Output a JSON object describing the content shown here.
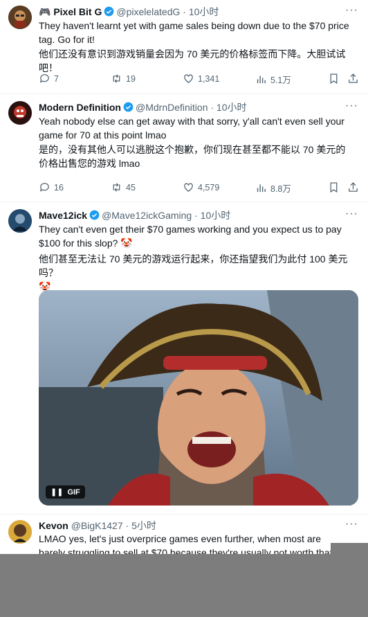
{
  "colors": {
    "verified": "#1d9bf0",
    "text": "#0f1419",
    "muted": "#536471",
    "overlay": "#7d7d7d"
  },
  "tweets": [
    {
      "name_prefix_icon": "gamepad-icon",
      "name": "Pixel Bit G",
      "handle": "@pixelelatedG",
      "time": "· 10小时",
      "text_en": "They haven't learnt yet with game sales being down due to the $70 price tag.  Go for it!",
      "text_zh": "他们还没有意识到游戏销量会因为 70 美元的价格标签而下降。大胆试试吧！",
      "replies": "7",
      "reposts": "19",
      "likes": "1,341",
      "views": "5.1万"
    },
    {
      "name": "Modern Definition",
      "handle": "@MdrnDefinition",
      "time": "· 10小时",
      "text_en": "Yeah nobody else can get away with that sorry, y'all can't even sell your game for 70 at this point lmao",
      "text_zh": "是的，没有其他人可以逃脱这个抱歉，你们现在甚至都不能以 70 美元的价格出售您的游戏 lmao",
      "replies": "16",
      "reposts": "45",
      "likes": "4,579",
      "views": "8.8万"
    },
    {
      "name": "Mave12ick",
      "handle": "@Mave12ickGaming",
      "time": "· 10小时",
      "text_en": "They can't even get their $70 games working and you expect us to pay $100 for this slop?",
      "text_zh": "他们甚至无法让 70 美元的游戏运行起来，你还指望我们为此付 100 美元吗？",
      "emoji": "🤡",
      "gif_label": "GIF"
    },
    {
      "name": "Kevon",
      "handle": "@BigK1427",
      "time": "· 5小时",
      "text_en": "LMAO yes, let's just overprice games even further, when most are barely struggling to sell at $70 because they're usually not worth that price."
    }
  ]
}
